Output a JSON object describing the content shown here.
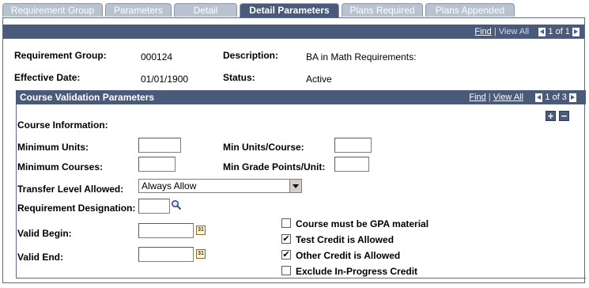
{
  "tabs": {
    "requirement_group": "Requirement Group",
    "parameters": "Parameters",
    "detail": "Detail",
    "detail_parameters": "Detail Parameters",
    "plans_required": "Plans Required",
    "plans_appended": "Plans Appended"
  },
  "header_nav": {
    "find": "Find",
    "separator": "|",
    "view_all": "View All",
    "paging": "1 of 1"
  },
  "summary": {
    "requirement_group_label": "Requirement Group:",
    "requirement_group_value": "000124",
    "description_label": "Description:",
    "description_value": "BA in Math Requirements:",
    "effective_date_label": "Effective Date:",
    "effective_date_value": "01/01/1900",
    "status_label": "Status:",
    "status_value": "Active"
  },
  "section": {
    "title": "Course Validation Parameters",
    "find": "Find",
    "separator": "|",
    "view_all": "View All",
    "paging": "1 of 3"
  },
  "course_info": {
    "heading": "Course Information:",
    "min_units_label": "Minimum Units:",
    "min_courses_label": "Minimum Courses:",
    "min_units_course_label": "Min Units/Course:",
    "min_grade_points_label": "Min Grade Points/Unit:",
    "transfer_level_label": "Transfer Level Allowed:",
    "transfer_level_value": "Always Allow",
    "req_designation_label": "Requirement Designation:",
    "valid_begin_label": "Valid Begin:",
    "valid_end_label": "Valid End:",
    "calendar_glyph": "31"
  },
  "checkboxes": {
    "gpa_label": "Course must be GPA material",
    "gpa_checked": false,
    "test_credit_label": "Test Credit is Allowed",
    "test_credit_checked": true,
    "other_credit_label": "Other Credit is Allowed",
    "other_credit_checked": true,
    "exclude_inprogress_label": "Exclude In-Progress Credit",
    "exclude_inprogress_checked": false,
    "check_glyph": "✔"
  },
  "colors": {
    "header_bar": "#4a5a7b",
    "tab_inactive": "#b9c3d0"
  }
}
